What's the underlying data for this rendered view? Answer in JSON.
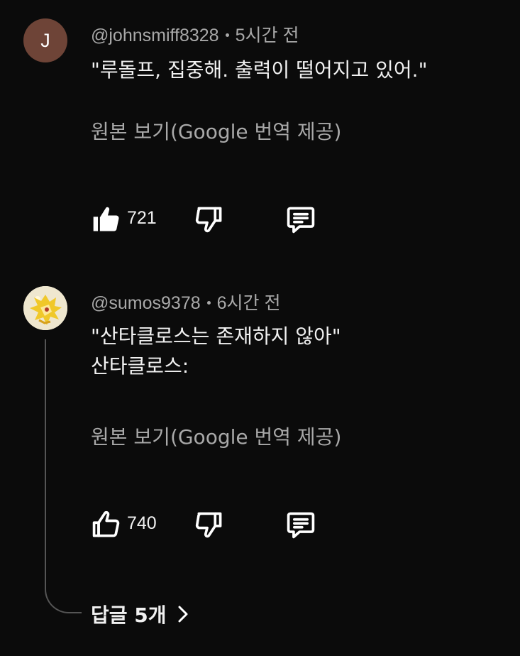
{
  "comments": [
    {
      "avatar_letter": "J",
      "avatar_color": "#6e4437",
      "author": "@johnsmiff8328",
      "time": "5시간 전",
      "lines": [
        "\"루돌프, 집중해. 출력이 떨어지고 있어.\""
      ],
      "translate_label": "원본 보기(Google 번역 제공)",
      "like_icon": "thumbs-up-filled-icon",
      "like_count": "721"
    },
    {
      "avatar_icon": "yellow-character-avatar",
      "author": "@sumos9378",
      "time": "6시간 전",
      "lines": [
        "\"산타클로스는 존재하지 않아\"",
        "산타클로스:"
      ],
      "translate_label": "원본 보기(Google 번역 제공)",
      "like_icon": "thumbs-up-outline-icon",
      "like_count": "740",
      "replies_label": "답글 5개"
    }
  ],
  "colors": {
    "background": "#0b0b0b",
    "primary_text": "#f1f1f1",
    "secondary_text": "#a9a9a9",
    "thread_line": "#555555"
  }
}
